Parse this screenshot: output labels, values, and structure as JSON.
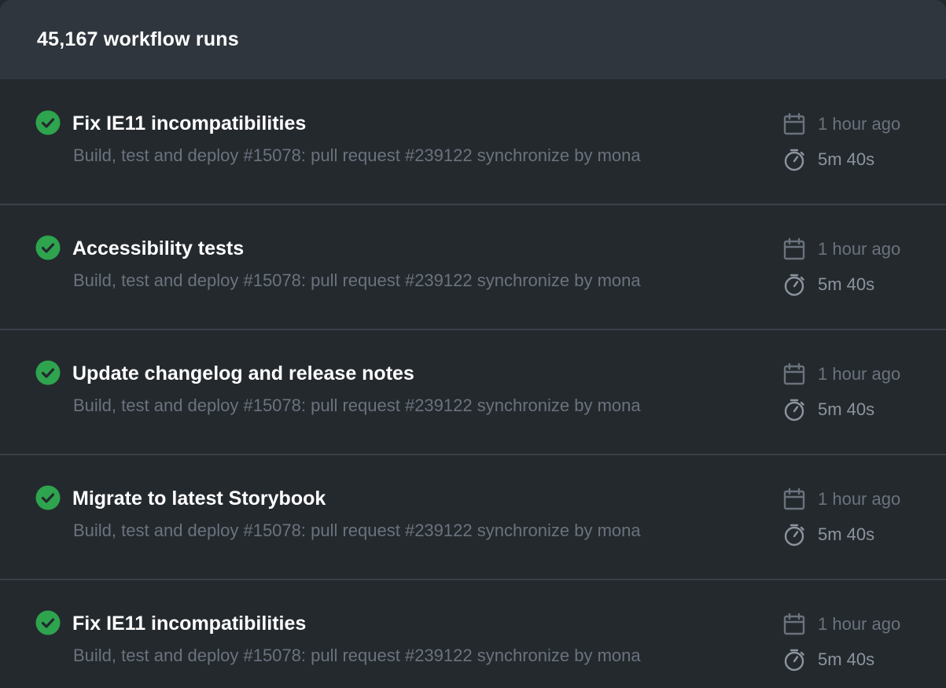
{
  "header": {
    "count_label": "45,167 workflow runs"
  },
  "runs": [
    {
      "title": "Fix IE11 incompatibilities",
      "subtitle": "Build, test and deploy #15078: pull request #239122 synchronize by mona",
      "time": "1 hour ago",
      "duration": "5m 40s",
      "status": "success"
    },
    {
      "title": "Accessibility tests",
      "subtitle": "Build, test and deploy #15078: pull request #239122 synchronize by mona",
      "time": "1 hour ago",
      "duration": "5m 40s",
      "status": "success"
    },
    {
      "title": "Update changelog and release notes",
      "subtitle": "Build, test and deploy #15078: pull request #239122 synchronize by mona",
      "time": "1 hour ago",
      "duration": "5m 40s",
      "status": "success"
    },
    {
      "title": "Migrate to latest Storybook",
      "subtitle": "Build, test and deploy #15078: pull request #239122 synchronize by mona",
      "time": "1 hour ago",
      "duration": "5m 40s",
      "status": "success"
    },
    {
      "title": "Fix IE11 incompatibilities",
      "subtitle": "Build, test and deploy #15078: pull request #239122 synchronize by mona",
      "time": "1 hour ago",
      "duration": "5m 40s",
      "status": "success"
    }
  ],
  "icons": {
    "status": "check-circle-icon",
    "time": "calendar-icon",
    "duration": "stopwatch-icon"
  },
  "colors": {
    "background": "#24292e",
    "header_background": "#2f363d",
    "success": "#2ea44f",
    "title_text": "#ffffff",
    "muted_text": "#6a737d",
    "divider": "#3a4047"
  }
}
